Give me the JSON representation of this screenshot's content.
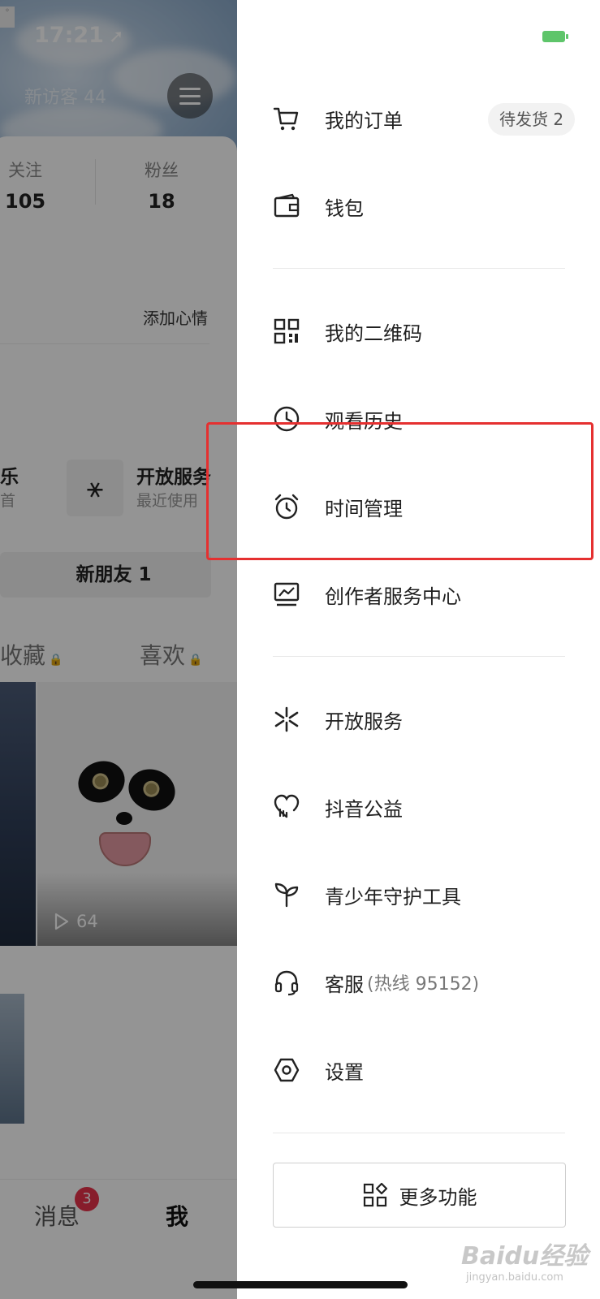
{
  "status_bar": {
    "time": "17:21"
  },
  "background": {
    "visitor_text": "新访客 44",
    "stats": [
      {
        "label": "关注",
        "value": "105"
      },
      {
        "label": "粉丝",
        "value": "18"
      }
    ],
    "mood_button": "添加心情",
    "services": [
      {
        "title": "乐",
        "subtitle": "首"
      },
      {
        "title": "开放服务",
        "subtitle": "最近使用"
      }
    ],
    "new_friend": "新朋友 1",
    "tabs": [
      {
        "label": "收藏"
      },
      {
        "label": "喜欢"
      }
    ],
    "play_count": "64",
    "bottom_nav": {
      "messages": "消息",
      "messages_badge": "3",
      "me": "我"
    }
  },
  "drawer": {
    "orders_badge": "待发货 2",
    "items": [
      {
        "icon": "cart-icon",
        "label": "我的订单"
      },
      {
        "icon": "wallet-icon",
        "label": "钱包"
      },
      {
        "icon": "qrcode-icon",
        "label": "我的二维码"
      },
      {
        "icon": "clock-icon",
        "label": "观看历史"
      },
      {
        "icon": "alarm-icon",
        "label": "时间管理"
      },
      {
        "icon": "chart-monitor-icon",
        "label": "创作者服务中心"
      },
      {
        "icon": "spark-icon",
        "label": "开放服务"
      },
      {
        "icon": "heart-hand-icon",
        "label": "抖音公益"
      },
      {
        "icon": "sprout-icon",
        "label": "青少年守护工具"
      },
      {
        "icon": "headset-icon",
        "label": "客服",
        "suffix": "(热线 95152)"
      },
      {
        "icon": "hex-settings-icon",
        "label": "设置"
      }
    ],
    "more_button": "更多功能"
  },
  "watermark": {
    "brand": "Baidu经验",
    "url": "jingyan.baidu.com"
  },
  "colors": {
    "highlight": "#e53030",
    "battery": "#5ec56a",
    "badge": "#e9334a"
  }
}
